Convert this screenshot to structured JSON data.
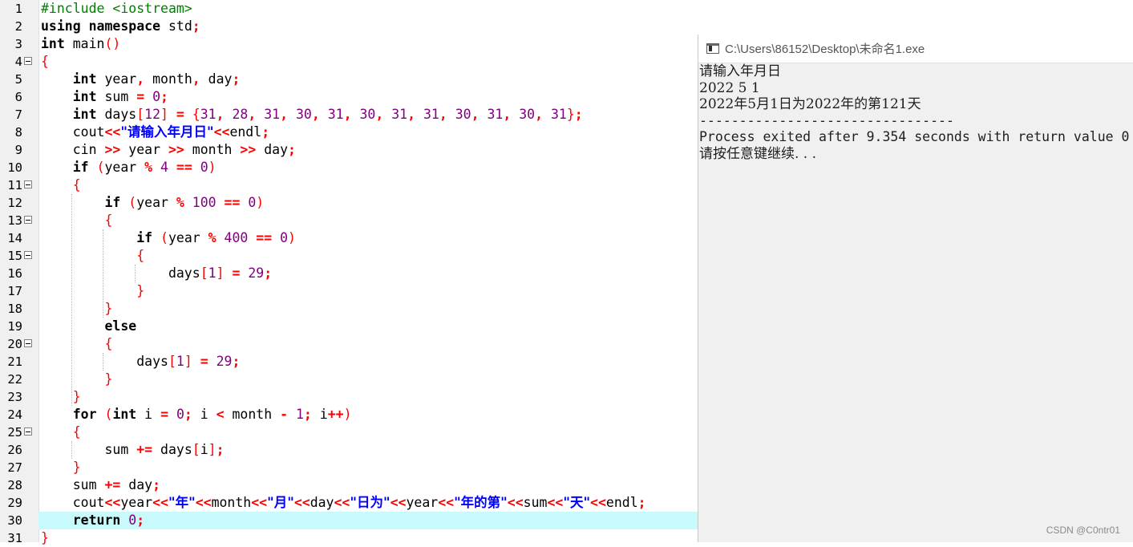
{
  "editor": {
    "current_line": 30,
    "line_numbers": [
      "1",
      "2",
      "3",
      "4",
      "5",
      "6",
      "7",
      "8",
      "9",
      "10",
      "11",
      "12",
      "13",
      "14",
      "15",
      "16",
      "17",
      "18",
      "19",
      "20",
      "21",
      "22",
      "23",
      "24",
      "25",
      "26",
      "27",
      "28",
      "29",
      "30",
      "31"
    ],
    "fold_lines": [
      4,
      11,
      13,
      15,
      20,
      25
    ]
  },
  "console": {
    "title": "C:\\Users\\86152\\Desktop\\未命名1.exe",
    "lines": [
      "请输入年月日",
      "2022 5 1",
      "2022年5月1日为2022年的第121天",
      "",
      "--------------------------------",
      "Process exited after 9.354 seconds with return value 0",
      "请按任意键继续. . ."
    ]
  },
  "watermark": "CSDN @C0ntr01",
  "colors": {
    "keyword": "#000000",
    "preprocessor": "#008000",
    "operator": "#ff0000",
    "number": "#800080",
    "string": "#0000ff",
    "current_line_bg": "#c8fafc",
    "console_bg": "#f0f0f0"
  }
}
